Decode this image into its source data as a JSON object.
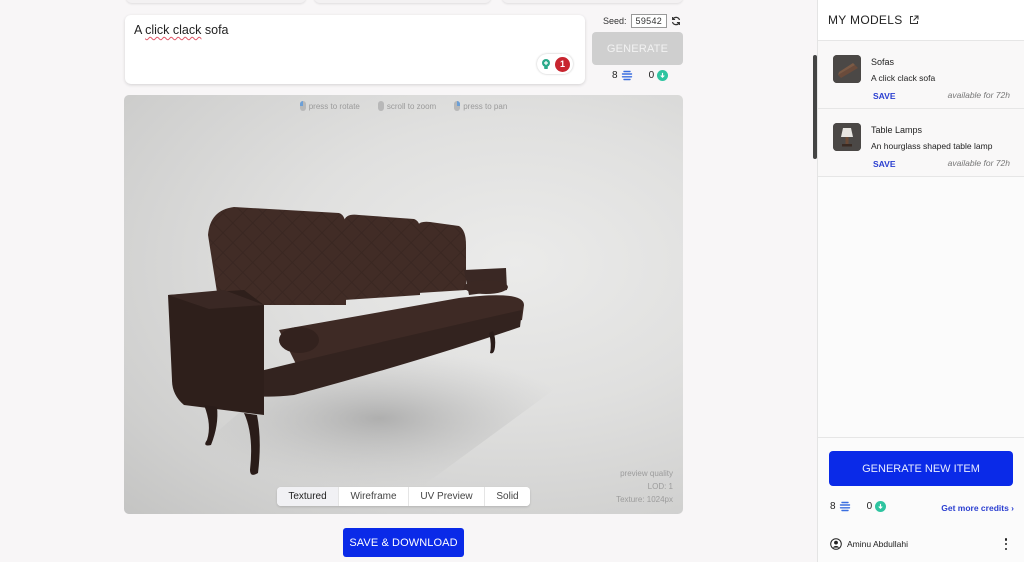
{
  "prompt": {
    "text_parts": [
      "A ",
      "click clack",
      " sofa"
    ],
    "suggestion_count": "1"
  },
  "seed": {
    "label": "Seed:",
    "value": "59542"
  },
  "generate_button": {
    "label": "GENERATE",
    "state": "disabled"
  },
  "credits": {
    "generations": "8",
    "downloads": "0"
  },
  "viewer": {
    "hints": [
      {
        "label": "press to rotate",
        "icon": "mouse-left-icon"
      },
      {
        "label": "scroll to zoom",
        "icon": "mouse-scroll-icon"
      },
      {
        "label": "press to pan",
        "icon": "mouse-right-icon"
      }
    ],
    "view_modes": [
      "Textured",
      "Wireframe",
      "UV Preview",
      "Solid"
    ],
    "active_view_mode": "Textured",
    "quality_lines": [
      "preview quality",
      "LOD: 1",
      "Texture: 1024px"
    ],
    "model_subject": "sofa"
  },
  "save_download_button": {
    "label": "SAVE & DOWNLOAD"
  },
  "sidebar": {
    "title": "MY MODELS",
    "models": [
      {
        "title": "Sofas",
        "description": "A click clack sofa",
        "save_label": "SAVE",
        "availability": "available for 72h",
        "thumb": "sofa"
      },
      {
        "title": "Table Lamps",
        "description": "An hourglass shaped table lamp",
        "save_label": "SAVE",
        "availability": "available for 72h",
        "thumb": "lamp"
      }
    ],
    "generate_new_label": "GENERATE NEW ITEM",
    "credits": {
      "generations": "8",
      "downloads": "0"
    },
    "get_more_credits": "Get more credits ›",
    "user_name": "Aminu Abdullahi"
  },
  "colors": {
    "primary": "#0a2ae8",
    "link": "#2a3ed0",
    "badge_red": "#c8252f",
    "download_green": "#2ec4a0",
    "sofa_leather": "#3a2722"
  }
}
